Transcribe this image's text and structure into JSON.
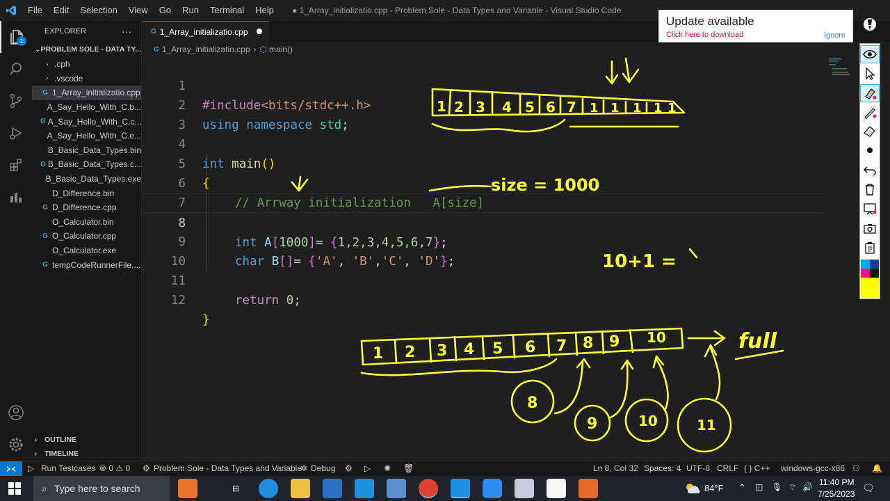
{
  "window": {
    "title": "● 1_Array_initializatio.cpp - Problem Sole - Data Types and Variable - Visual Studio Code",
    "menu": [
      "File",
      "Edit",
      "Selection",
      "View",
      "Go",
      "Run",
      "Terminal",
      "Help"
    ]
  },
  "activity_bar": {
    "explorer_badge": "1",
    "icons": [
      "files-icon",
      "search-icon",
      "source-control-icon",
      "run-debug-icon",
      "extensions-icon",
      "chart-icon",
      "account-icon",
      "settings-gear-icon"
    ]
  },
  "sidebar": {
    "header": "EXPLORER",
    "more": "···",
    "folder": "PROBLEM SOLE - DATA TY...",
    "items": [
      {
        "label": ".cph",
        "kind": "folder",
        "icon": ""
      },
      {
        "label": ".vscode",
        "kind": "folder",
        "icon": ""
      },
      {
        "label": "1_Array_initializatio.cpp",
        "kind": "cpp",
        "icon": "G",
        "selected": true
      },
      {
        "label": "A_Say_Hello_With_C.b...",
        "kind": "bin",
        "icon": ""
      },
      {
        "label": "A_Say_Hello_With_C.c...",
        "kind": "cpp",
        "icon": "G"
      },
      {
        "label": "A_Say_Hello_With_C.e...",
        "kind": "exe",
        "icon": ""
      },
      {
        "label": "B_Basic_Data_Types.bin",
        "kind": "bin",
        "icon": ""
      },
      {
        "label": "B_Basic_Data_Types.c...",
        "kind": "cpp",
        "icon": "G"
      },
      {
        "label": "B_Basic_Data_Types.exe",
        "kind": "exe",
        "icon": ""
      },
      {
        "label": "D_Difference.bin",
        "kind": "bin",
        "icon": ""
      },
      {
        "label": "D_Difference.cpp",
        "kind": "cpp",
        "icon": "G"
      },
      {
        "label": "O_Calculator.bin",
        "kind": "bin",
        "icon": ""
      },
      {
        "label": "O_Calculator.cpp",
        "kind": "cpp",
        "icon": "G"
      },
      {
        "label": "O_Calculator.exe",
        "kind": "exe",
        "icon": ""
      },
      {
        "label": "tempCodeRunnerFile....",
        "kind": "cpp",
        "icon": "G"
      }
    ],
    "outline": "OUTLINE",
    "timeline": "TIMELINE"
  },
  "editor": {
    "tab": "1_Array_initializatio.cpp",
    "breadcrumb": [
      "1_Array_initializatio.cpp",
      "main()"
    ],
    "line_numbers": [
      "1",
      "2",
      "3",
      "4",
      "5",
      "6",
      "7",
      "8",
      "9",
      "10",
      "11",
      "12"
    ],
    "code": {
      "l1_pre": "#include",
      "l1_inc": "<bits/stdc++.h>",
      "l2_using": "using",
      "l2_ns": "namespace",
      "l2_std": "std",
      "l2_semi": ";",
      "l4_int": "int",
      "l4_main": "main",
      "l4_paren": "()",
      "l5_brace": "{",
      "l6_comment": "// Arrway initialization   A[size]",
      "l8_int": "int",
      "l8_a": "A",
      "l8_lb": "[",
      "l8_size": "1000",
      "l8_rb": "]",
      "l8_eq": "= ",
      "l8_lbr": "{",
      "l8_vals": "1,2,3,4,5,6,7",
      "l8_rbr": "}",
      "l8_semi": ";",
      "l9_char": "char",
      "l9_b": "B",
      "l9_br": "[]",
      "l9_eq": "= ",
      "l9_lbr": "{",
      "l9_s1": "'A'",
      "l9_c1": ", ",
      "l9_s2": "'B'",
      "l9_c2": ",",
      "l9_s3": "'C'",
      "l9_c3": ", ",
      "l9_s4": "'D'",
      "l9_rbr": "}",
      "l9_semi": ";",
      "l11_return": "return",
      "l11_zero": "0",
      "l11_semi": ";",
      "l12_brace": "}"
    }
  },
  "notification": {
    "title": "Update available",
    "link": "Click here to download",
    "ignore": "ignore"
  },
  "annotations": {
    "top_array": [
      "1",
      "2",
      "3",
      "4",
      "5",
      "6",
      "7",
      "1",
      "1",
      "1",
      "1",
      "1"
    ],
    "arrows_top": "↓↓",
    "size_note": "size = 1000",
    "sum_note": "10+1 =",
    "bottom_array": [
      "1",
      "2",
      "3",
      "4",
      "5",
      "6",
      "7",
      "8",
      "9",
      "10"
    ],
    "full_note": "full",
    "circles": [
      "8",
      "9",
      "10",
      "11"
    ]
  },
  "status_bar": {
    "run_testcases": "Run Testcases",
    "problems": "⊗ 0 ⚠ 0",
    "workspace": "Problem Sole - Data Types and Variable",
    "debug": "Debug",
    "position": "Ln 8, Col 32",
    "spaces": "Spaces: 4",
    "encoding": "UTF-8",
    "eol": "CRLF",
    "language": "{ } C++",
    "compiler": "windows-gcc-x86"
  },
  "taskbar": {
    "search_placeholder": "Type here to search",
    "temperature": "84°F",
    "time": "11:40 PM",
    "date": "7/25/2023"
  },
  "colors": {
    "accent": "#0078d4",
    "ink": "#ffff33",
    "editor_bg": "#1f1f1f"
  }
}
